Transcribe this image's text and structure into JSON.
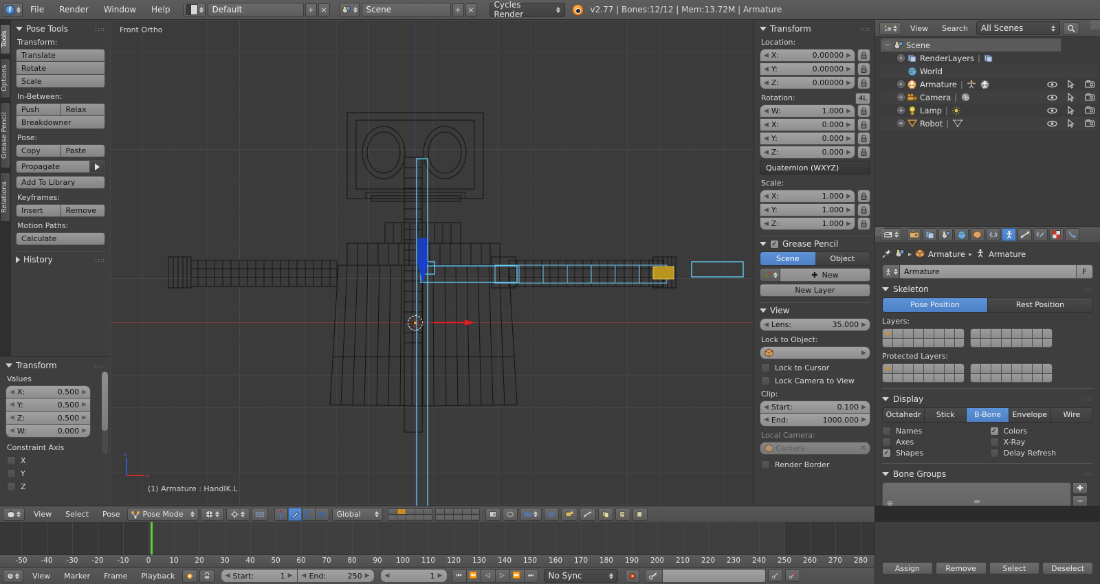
{
  "topbar": {
    "menus": [
      "File",
      "Render",
      "Window",
      "Help"
    ],
    "screen_layout": "Default",
    "scene_name": "Scene",
    "engine": "Cycles Render",
    "status": "v2.77 | Bones:12/12 | Mem:13.72M | Armature",
    "icons": {
      "info": "info-icon",
      "layout": "screen-layout-icon",
      "scene": "scene-icon",
      "blender": "blender-logo-icon",
      "add": "+",
      "remove": "×"
    }
  },
  "toolshelf": {
    "tabs": [
      "Tools",
      "Options",
      "Grease Pencil",
      "Relations"
    ],
    "active_tab": "Tools",
    "panel_title": "Pose Tools",
    "groups": [
      {
        "label": "Transform:",
        "buttons": [
          "Translate",
          "Rotate",
          "Scale"
        ]
      },
      {
        "label": "In-Between:",
        "buttons": [
          "Push",
          "Relax",
          "Breakdowner"
        ]
      },
      {
        "label": "Pose:",
        "buttons": [
          "Copy",
          "Paste",
          "Propagate",
          "Add To Library"
        ]
      },
      {
        "label": "Keyframes:",
        "buttons": [
          "Insert",
          "Remove"
        ]
      },
      {
        "label": "Motion Paths:",
        "buttons": [
          "Calculate"
        ]
      }
    ],
    "history_title": "History"
  },
  "operator_panel": {
    "title": "Transform",
    "values_label": "Values",
    "fields": [
      {
        "label": "X:",
        "value": "0.500"
      },
      {
        "label": "Y:",
        "value": "0.500"
      },
      {
        "label": "Z:",
        "value": "0.500"
      },
      {
        "label": "W:",
        "value": "0.000"
      }
    ],
    "constraint_label": "Constraint Axis",
    "axes": [
      {
        "label": "X",
        "checked": false
      },
      {
        "label": "Y",
        "checked": false
      },
      {
        "label": "Z",
        "checked": false
      }
    ]
  },
  "viewport": {
    "view_label": "Front Ortho",
    "info_text": "(1) Armature : HandIK.L",
    "axis_z": "z",
    "axis_x": "x",
    "header": {
      "menus": [
        "View",
        "Select",
        "Pose"
      ],
      "mode": "Pose Mode",
      "orientation": "Global",
      "icons": [
        "editor-type-icon",
        "pose-mode-icon",
        "viewport-shading-icon",
        "pivot-point-icon",
        "snap-magnet-icon",
        "manipulator-translate-icon",
        "manipulator-rotate-icon",
        "manipulator-scale-icon",
        "proportional-edit-icon",
        "render-opengl-icon",
        "lock-icon",
        "ghost-icon"
      ]
    }
  },
  "npanel": {
    "transform_title": "Transform",
    "location_label": "Location:",
    "location": [
      {
        "label": "X:",
        "value": "0.00000"
      },
      {
        "label": "Y:",
        "value": "0.00000"
      },
      {
        "label": "Z:",
        "value": "0.00000"
      }
    ],
    "rotation_label": "Rotation:",
    "rotation_badge": "4L",
    "rotation": [
      {
        "label": "W:",
        "value": "1.000"
      },
      {
        "label": "X:",
        "value": "0.000"
      },
      {
        "label": "Y:",
        "value": "0.000"
      },
      {
        "label": "Z:",
        "value": "0.000"
      }
    ],
    "rotation_mode": "Quaternion (WXYZ)",
    "scale_label": "Scale:",
    "scale": [
      {
        "label": "X:",
        "value": "1.000"
      },
      {
        "label": "Y:",
        "value": "1.000"
      },
      {
        "label": "Z:",
        "value": "1.000"
      }
    ],
    "grease_pencil": {
      "title": "Grease Pencil",
      "checked": true,
      "tabs": [
        "Scene",
        "Object"
      ],
      "active_tab": "Scene",
      "new_button": "New",
      "new_layer_button": "New Layer"
    },
    "view": {
      "title": "View",
      "lens_label": "Lens:",
      "lens_value": "35.000",
      "lock_object_label": "Lock to Object:",
      "lock_object_value": "",
      "lock_cursor": {
        "label": "Lock to Cursor",
        "checked": false
      },
      "lock_camera": {
        "label": "Lock Camera to View",
        "checked": false
      },
      "clip_label": "Clip:",
      "clip_start": {
        "label": "Start:",
        "value": "0.100"
      },
      "clip_end": {
        "label": "End:",
        "value": "1000.000"
      },
      "local_camera_label": "Local Camera:",
      "local_camera_value": "Camera",
      "render_border": {
        "label": "Render Border",
        "checked": false
      }
    }
  },
  "outliner": {
    "menus": [
      "View",
      "Search"
    ],
    "display_mode": "All Scenes",
    "rows": [
      {
        "name": "Scene",
        "indent": 0,
        "icon": "scene-icon",
        "selected": true,
        "expandable": true,
        "expanded": true,
        "tools": false
      },
      {
        "name": "RenderLayers",
        "indent": 1,
        "icon": "renderlayers-icon",
        "selected": false,
        "expandable": true,
        "expanded": false,
        "tools": false
      },
      {
        "name": "World",
        "indent": 2,
        "icon": "world-icon",
        "selected": false,
        "expandable": false,
        "expanded": false,
        "tools": false
      },
      {
        "name": "Armature",
        "indent": 1,
        "icon": "armature-icon",
        "selected": false,
        "expandable": true,
        "expanded": false,
        "tools": true
      },
      {
        "name": "Camera",
        "indent": 1,
        "icon": "camera-icon",
        "selected": false,
        "expandable": true,
        "expanded": false,
        "tools": true
      },
      {
        "name": "Lamp",
        "indent": 1,
        "icon": "lamp-icon",
        "selected": false,
        "expandable": true,
        "expanded": false,
        "tools": true
      },
      {
        "name": "Robot",
        "indent": 1,
        "icon": "mesh-icon",
        "selected": false,
        "expandable": true,
        "expanded": false,
        "tools": true
      }
    ]
  },
  "properties": {
    "tabs": [
      "render-icon",
      "renderlayers-icon",
      "scene-icon",
      "world-icon",
      "object-icon",
      "constraints-icon",
      "armature-data-icon",
      "bone-icon",
      "bone-constraint-icon",
      "texture-icon",
      "physics-icon"
    ],
    "active_tab_index": 6,
    "breadcrumb": [
      "Armature",
      "Armature"
    ],
    "datablock_name": "Armature",
    "fake_user": "F",
    "skeleton": {
      "title": "Skeleton",
      "positions": [
        "Pose Position",
        "Rest Position"
      ],
      "active_position": "Pose Position",
      "layers_label": "Layers:",
      "protected_label": "Protected Layers:",
      "layers_active_index": 0,
      "protected_active_index": 0
    },
    "display": {
      "title": "Display",
      "modes": [
        "Octahedr",
        "Stick",
        "B-Bone",
        "Envelope",
        "Wire"
      ],
      "active_mode": "B-Bone",
      "options": [
        {
          "label": "Names",
          "checked": false
        },
        {
          "label": "Colors",
          "checked": true
        },
        {
          "label": "Axes",
          "checked": false
        },
        {
          "label": "X-Ray",
          "checked": false
        },
        {
          "label": "Shapes",
          "checked": true
        },
        {
          "label": "Delay Refresh",
          "checked": false
        }
      ]
    },
    "bone_groups": {
      "title": "Bone Groups",
      "buttons": [
        "Assign",
        "Remove",
        "Select",
        "Deselect"
      ]
    }
  },
  "timeline": {
    "menus": [
      "View",
      "Marker",
      "Frame",
      "Playback"
    ],
    "start": {
      "label": "Start:",
      "value": "1"
    },
    "end": {
      "label": "End:",
      "value": "250"
    },
    "current_frame": "1",
    "sync_mode": "No Sync",
    "ruler_ticks": [
      -50,
      -40,
      -30,
      -20,
      -10,
      0,
      10,
      20,
      30,
      40,
      50,
      60,
      70,
      80,
      90,
      100,
      110,
      120,
      130,
      140,
      150,
      160,
      170,
      180,
      190,
      200,
      210,
      220,
      230,
      240,
      250,
      260,
      270,
      280
    ],
    "playhead_frame": 1,
    "icons": {
      "editor": "timeline-editor-icon",
      "auto_key": "record-icon",
      "lock": "lock-icon",
      "jump_start": "⏮",
      "prev_key": "⏪",
      "play_rev": "◁",
      "play": "▷",
      "next_key": "⏩",
      "jump_end": "⏭",
      "keyingset": "keying-set-icon"
    }
  },
  "colors": {
    "accent_blue": "#4d80c6",
    "bone_cyan": "#5ec8f5",
    "playhead_green": "#5ad13a",
    "axis_red": "#7d3b3b",
    "axis_blue": "#3b4a78",
    "layer_orange": "#e08a1e",
    "bg_panel": "#3e3e3e",
    "bg_viewport": "#3b3b3b"
  }
}
